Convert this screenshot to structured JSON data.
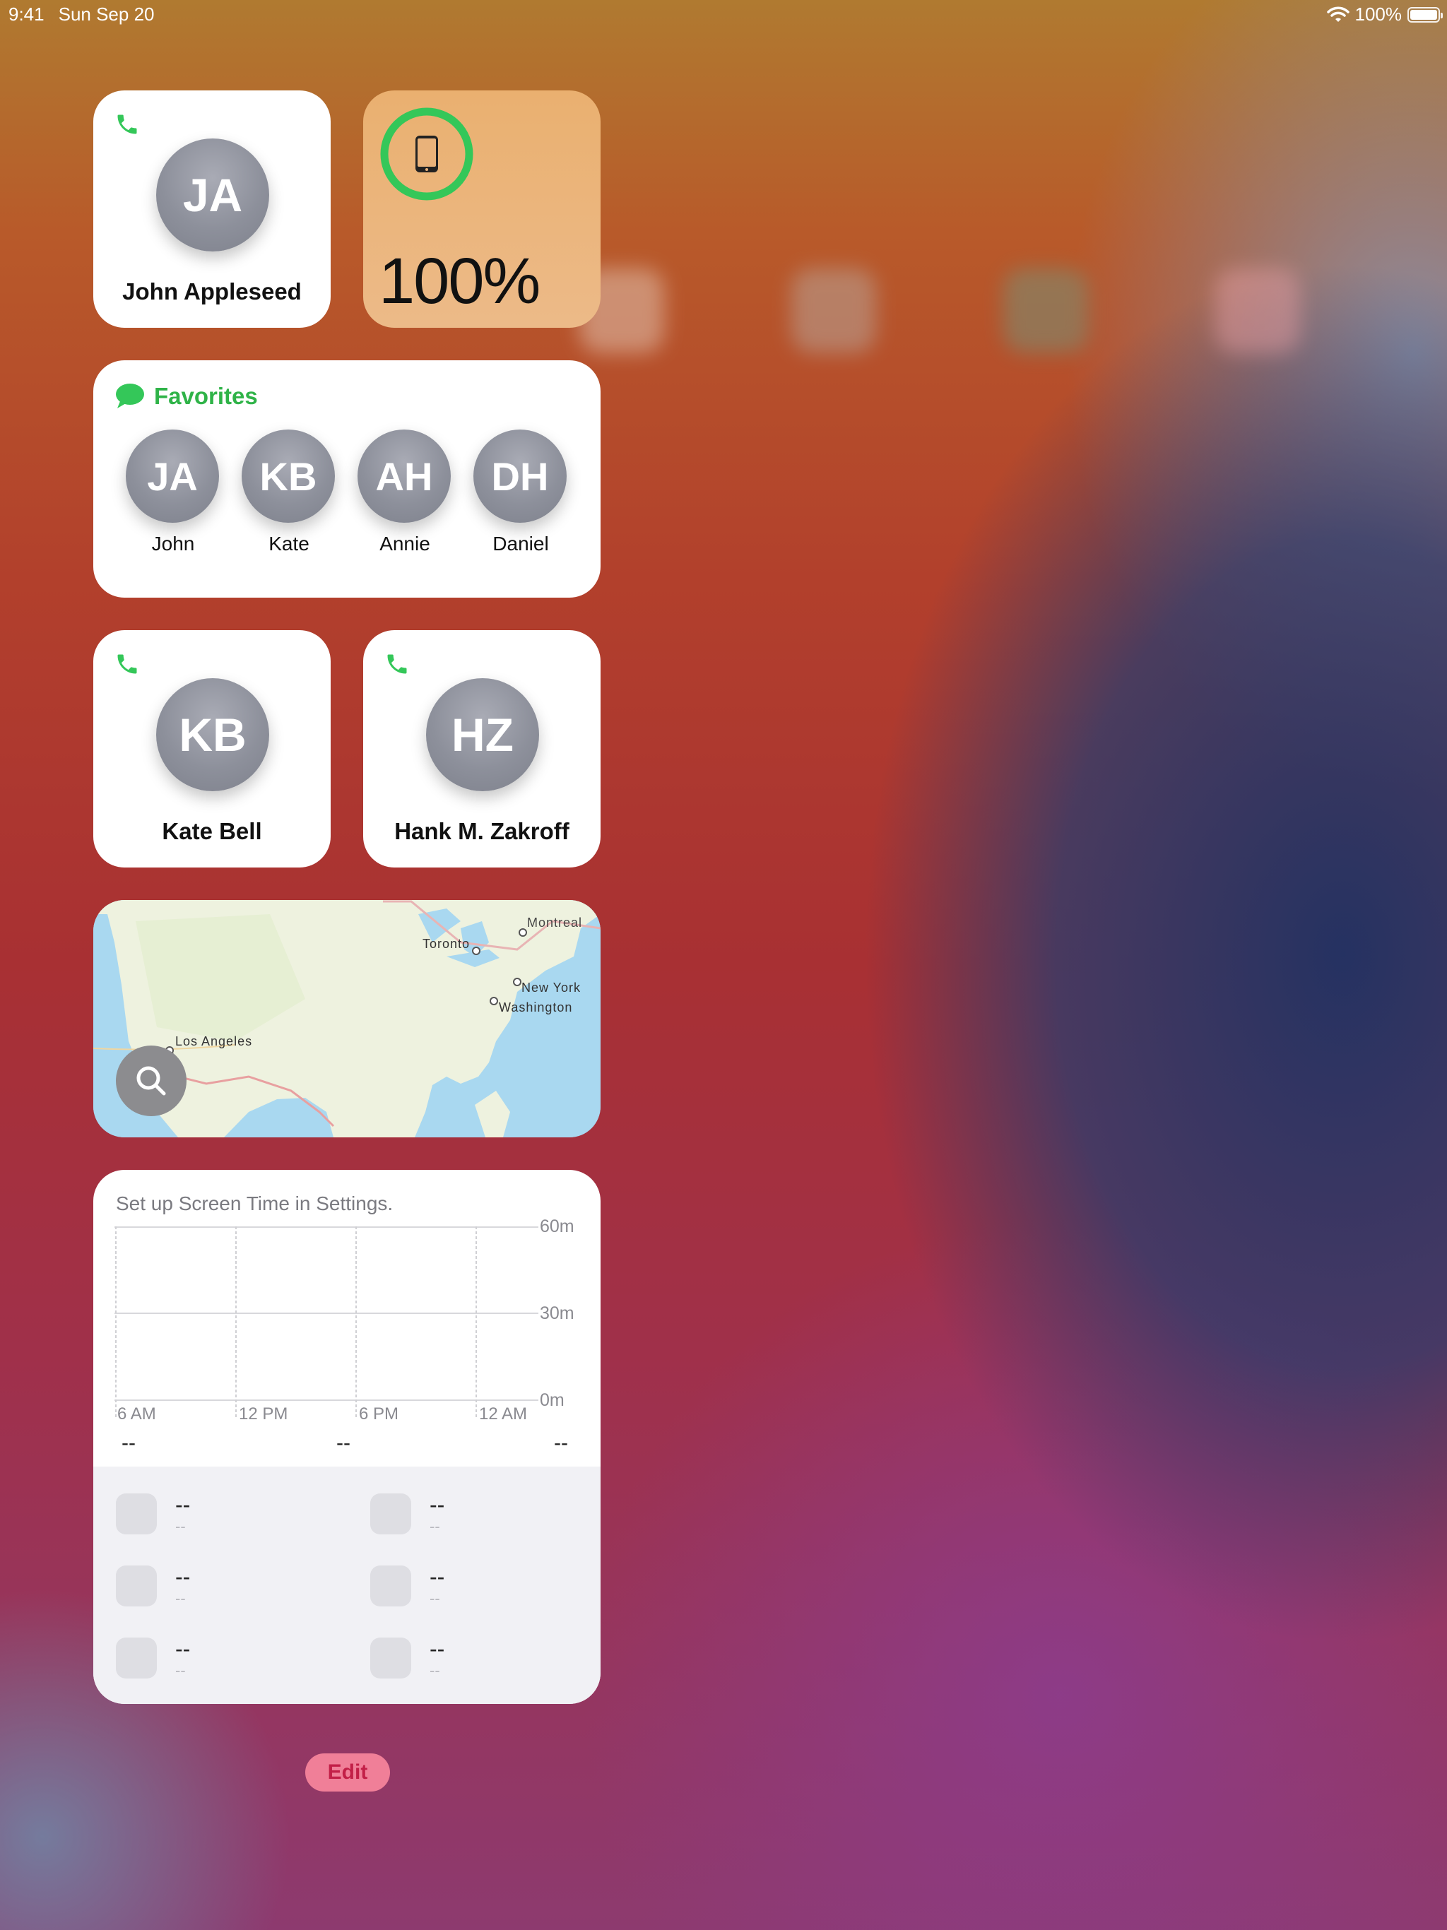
{
  "status_bar": {
    "time": "9:41",
    "date": "Sun Sep 20",
    "battery": "100%"
  },
  "contact_widgets": [
    {
      "initials": "JA",
      "name": "John Appleseed"
    },
    {
      "initials": "KB",
      "name": "Kate Bell"
    },
    {
      "initials": "HZ",
      "name": "Hank M. Zakroff"
    }
  ],
  "battery_widget": {
    "percent": "100%",
    "device_icon": "ipad-icon",
    "ring_color": "#34c759"
  },
  "favorites": {
    "title": "Favorites",
    "items": [
      {
        "initials": "JA",
        "label": "John"
      },
      {
        "initials": "KB",
        "label": "Kate"
      },
      {
        "initials": "AH",
        "label": "Annie"
      },
      {
        "initials": "DH",
        "label": "Daniel"
      }
    ]
  },
  "map": {
    "cities": [
      "Montreal",
      "Toronto",
      "New York",
      "Washington",
      "Los Angeles"
    ],
    "search_icon": "magnifier-icon"
  },
  "screen_time": {
    "message": "Set up Screen Time in Settings.",
    "y_ticks": [
      "60m",
      "30m",
      "0m"
    ],
    "x_ticks": [
      "6 AM",
      "12 PM",
      "6 PM",
      "12 AM"
    ],
    "totals": [
      "--",
      "--",
      "--"
    ],
    "app_rows": [
      {
        "name": "--",
        "time": "--"
      },
      {
        "name": "--",
        "time": "--"
      },
      {
        "name": "--",
        "time": "--"
      },
      {
        "name": "--",
        "time": "--"
      },
      {
        "name": "--",
        "time": "--"
      },
      {
        "name": "--",
        "time": "--"
      }
    ]
  },
  "edit_button": "Edit",
  "colors": {
    "accent_green": "#34c759",
    "edit_pink": "#f07f98"
  }
}
